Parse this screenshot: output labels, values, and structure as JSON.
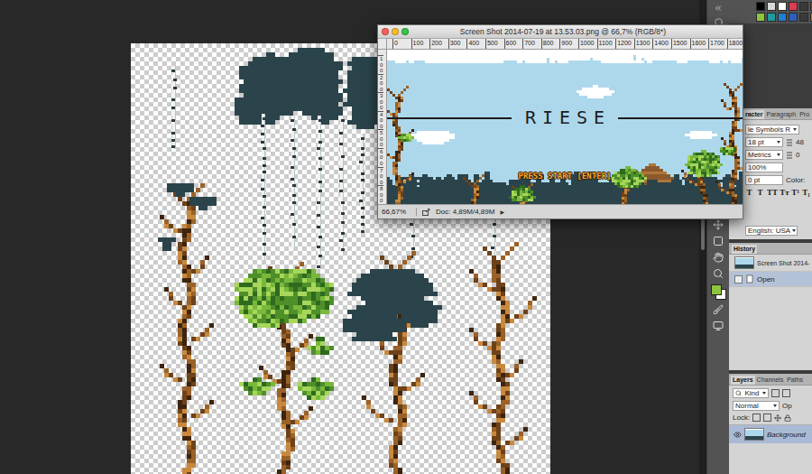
{
  "swatches": [
    {
      "color": "#000000"
    },
    {
      "color": "#d8d8d8"
    },
    {
      "color": "#ffffff"
    },
    {
      "color": "#e23a52"
    },
    {
      "color": "#3a3a3a"
    },
    {
      "color": "#7a4a20"
    },
    {
      "color": "#8cc63f"
    },
    {
      "color": "#1f9aa0"
    },
    {
      "color": "#1f7fd0"
    },
    {
      "color": "#2f5fb8"
    },
    {
      "color": "#3a3a3a"
    },
    {
      "color": "#c07a2a"
    }
  ],
  "document": {
    "title": "Screen Shot 2014-07-19 at 13.53.03.png @ 66,7% (RGB/8*)",
    "horizontal_ruler": [
      "0",
      "100",
      "200",
      "300",
      "400",
      "500",
      "600",
      "700",
      "800",
      "900",
      "1000",
      "1100",
      "1200",
      "1300",
      "1400",
      "1500",
      "1600",
      "1700",
      "1800"
    ],
    "vertical_ruler": [
      "100",
      "200",
      "300",
      "400",
      "500",
      "600",
      "700",
      "800"
    ],
    "game": {
      "title": "RIESE",
      "prompt": "PRESS START [ENTER]"
    },
    "status": {
      "zoom": "66,67%",
      "doc": "Doc: 4,89M/4,89M",
      "menu_arrow": "▶"
    }
  },
  "character_panel": {
    "tabs": [
      {
        "label": "racter",
        "selected": true
      },
      {
        "label": "Paragraph",
        "selected": false
      },
      {
        "label": "Pro",
        "selected": false
      }
    ],
    "font_family": "le Symbols R",
    "font_size": "18 pt",
    "leading": "48",
    "kerning": "Metrics",
    "tracking": "0",
    "vertical_scale": "100%",
    "baseline_shift": "0 pt",
    "color_label": "Color:",
    "style_buttons": [
      "T",
      "T",
      "TT",
      "Tт",
      "T¹",
      "T₁"
    ],
    "language": "English: USA"
  },
  "history_panel": {
    "title": "History",
    "snapshot": "Screen Shot 2014-",
    "items": [
      {
        "label": "Open",
        "selected": true
      }
    ]
  },
  "layers_panel": {
    "tabs": [
      {
        "label": "Layers",
        "selected": true
      },
      {
        "label": "Channels",
        "selected": false
      },
      {
        "label": "Paths",
        "selected": false
      }
    ],
    "filter": "Kind",
    "blend_mode": "Normal",
    "opacity_label": "Op",
    "lock_label": "Lock:",
    "layers": [
      {
        "name": "Background",
        "visible": true,
        "selected": true
      }
    ]
  }
}
